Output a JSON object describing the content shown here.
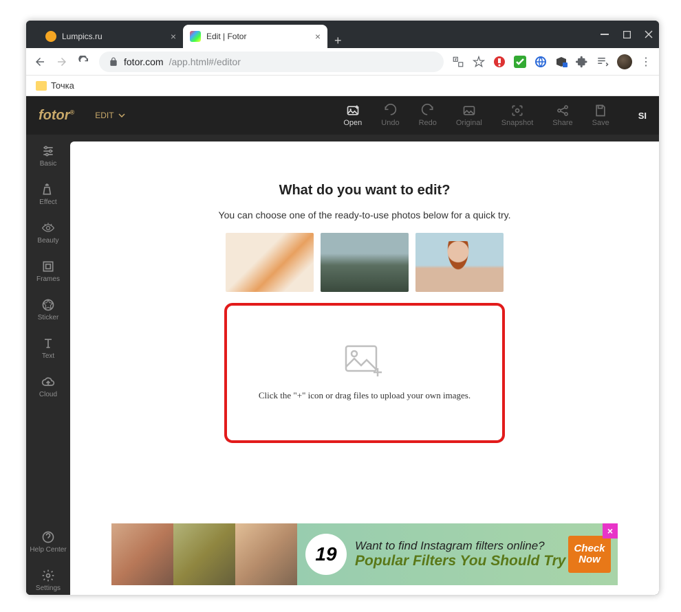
{
  "browser": {
    "tabs": [
      {
        "title": "Lumpics.ru"
      },
      {
        "title": "Edit | Fotor"
      }
    ],
    "url_host": "fotor.com",
    "url_path": "/app.html#/editor",
    "bookmark": "Точка"
  },
  "app": {
    "logo": "fotor",
    "mode": "EDIT",
    "tools": {
      "open": "Open",
      "undo": "Undo",
      "redo": "Redo",
      "original": "Original",
      "snapshot": "Snapshot",
      "share": "Share",
      "save": "Save"
    },
    "si": "SI"
  },
  "sidebar": {
    "basic": "Basic",
    "effect": "Effect",
    "beauty": "Beauty",
    "frames": "Frames",
    "sticker": "Sticker",
    "text": "Text",
    "cloud": "Cloud",
    "help": "Help Center",
    "settings": "Settings"
  },
  "main": {
    "heading": "What do you want to edit?",
    "subtext": "You can choose one of the ready-to-use photos below for a quick try.",
    "dropzone_text": "Click the \"+\" icon or drag files to upload your own images."
  },
  "ad": {
    "number": "19",
    "line1": "Want to find Instagram filters online?",
    "line2": "Popular Filters You Should Try",
    "cta1": "Check",
    "cta2": "Now"
  }
}
